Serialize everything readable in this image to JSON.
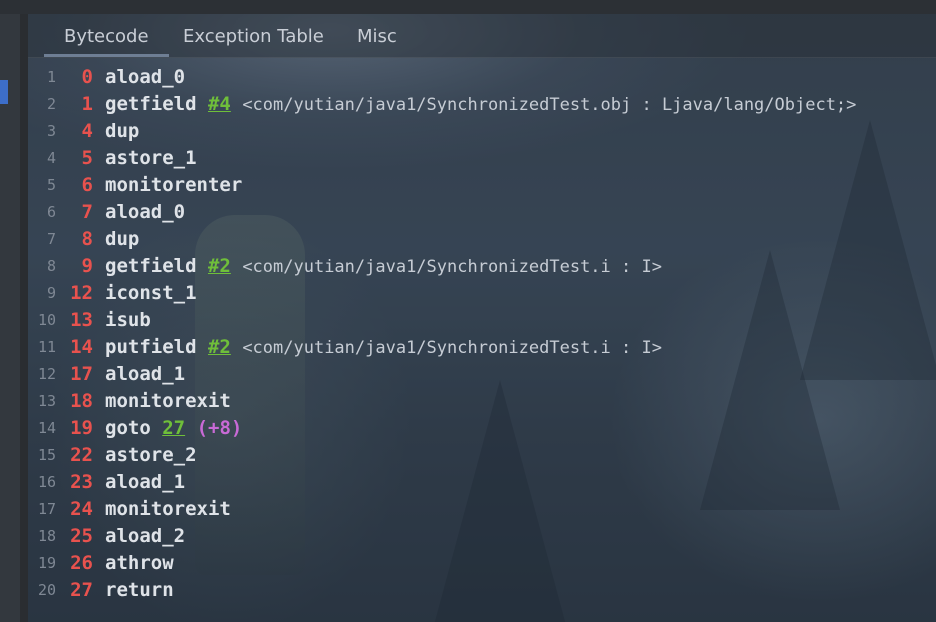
{
  "tabs": [
    {
      "label": "Bytecode",
      "active": true
    },
    {
      "label": "Exception Table",
      "active": false
    },
    {
      "label": "Misc",
      "active": false
    }
  ],
  "lines": [
    {
      "num": "1",
      "offset": "0",
      "op": "aload_0"
    },
    {
      "num": "2",
      "offset": "1",
      "op": "getfield",
      "ref": "#4",
      "desc": "<com/yutian/java1/SynchronizedTest.obj : Ljava/lang/Object;>"
    },
    {
      "num": "3",
      "offset": "4",
      "op": "dup"
    },
    {
      "num": "4",
      "offset": "5",
      "op": "astore_1"
    },
    {
      "num": "5",
      "offset": "6",
      "op": "monitorenter"
    },
    {
      "num": "6",
      "offset": "7",
      "op": "aload_0"
    },
    {
      "num": "7",
      "offset": "8",
      "op": "dup"
    },
    {
      "num": "8",
      "offset": "9",
      "op": "getfield",
      "ref": "#2",
      "desc": "<com/yutian/java1/SynchronizedTest.i : I>"
    },
    {
      "num": "9",
      "offset": "12",
      "op": "iconst_1"
    },
    {
      "num": "10",
      "offset": "13",
      "op": "isub"
    },
    {
      "num": "11",
      "offset": "14",
      "op": "putfield",
      "ref": "#2",
      "desc": "<com/yutian/java1/SynchronizedTest.i : I>"
    },
    {
      "num": "12",
      "offset": "17",
      "op": "aload_1"
    },
    {
      "num": "13",
      "offset": "18",
      "op": "monitorexit"
    },
    {
      "num": "14",
      "offset": "19",
      "op": "goto",
      "ref": "27",
      "delta": "(+8)"
    },
    {
      "num": "15",
      "offset": "22",
      "op": "astore_2"
    },
    {
      "num": "16",
      "offset": "23",
      "op": "aload_1"
    },
    {
      "num": "17",
      "offset": "24",
      "op": "monitorexit"
    },
    {
      "num": "18",
      "offset": "25",
      "op": "aload_2"
    },
    {
      "num": "19",
      "offset": "26",
      "op": "athrow"
    },
    {
      "num": "20",
      "offset": "27",
      "op": "return"
    }
  ],
  "colors": {
    "offset": "#e8524e",
    "reference": "#6fbf3a",
    "jump_delta": "#c86ad6",
    "instruction": "#dfe3e8"
  }
}
